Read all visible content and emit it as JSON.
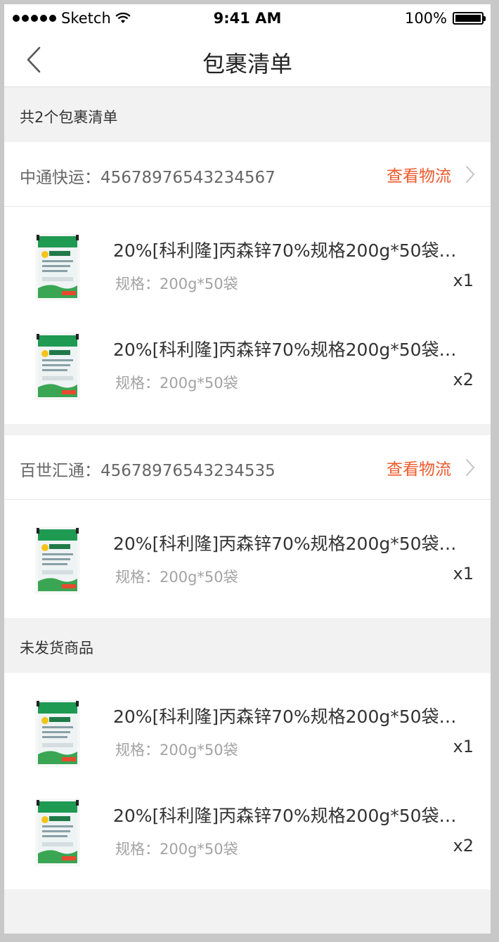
{
  "status_bar": {
    "carrier": "Sketch",
    "time": "9:41 AM",
    "battery": "100%"
  },
  "nav": {
    "title": "包裹清单",
    "back_icon": "chevron-left-icon"
  },
  "summary": {
    "label": "共2个包裹清单"
  },
  "packages": [
    {
      "carrier_label": "中通快运：45678976543234567",
      "track_label": "查看物流",
      "items": [
        {
          "name": "20%[科利隆]丙森锌70%规格200g*50袋…",
          "spec": "规格：200g*50袋",
          "qty": "x1"
        },
        {
          "name": "20%[科利隆]丙森锌70%规格200g*50袋…",
          "spec": "规格：200g*50袋",
          "qty": "x2"
        }
      ]
    },
    {
      "carrier_label": "百世汇通：45678976543234535",
      "track_label": "查看物流",
      "items": [
        {
          "name": "20%[科利隆]丙森锌70%规格200g*50袋…",
          "spec": "规格：200g*50袋",
          "qty": "x1"
        }
      ]
    }
  ],
  "unshipped": {
    "label": "未发货商品",
    "items": [
      {
        "name": "20%[科利隆]丙森锌70%规格200g*50袋…",
        "spec": "规格：200g*50袋",
        "qty": "x1"
      },
      {
        "name": "20%[科利隆]丙森锌70%规格200g*50袋…",
        "spec": "规格：200g*50袋",
        "qty": "x2"
      }
    ]
  },
  "colors": {
    "accent": "#ef5a2c",
    "background": "#f2f2f2"
  }
}
